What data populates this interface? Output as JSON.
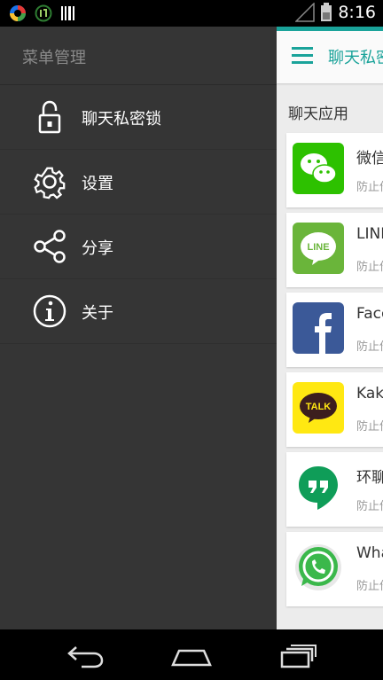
{
  "status_bar": {
    "time": "8:16"
  },
  "drawer": {
    "title": "菜单管理",
    "items": [
      {
        "label": "聊天私密锁",
        "icon": "padlock-icon"
      },
      {
        "label": "设置",
        "icon": "gear-icon"
      },
      {
        "label": "分享",
        "icon": "share-icon"
      },
      {
        "label": "关于",
        "icon": "info-icon"
      }
    ]
  },
  "main": {
    "toolbar_title": "聊天私密锁",
    "section_title": "聊天应用",
    "apps": [
      {
        "name": "微信",
        "desc": "防止他人查看",
        "icon": "wechat-icon"
      },
      {
        "name": "LINE",
        "desc": "防止他人查看",
        "icon": "line-icon"
      },
      {
        "name": "Facebook",
        "desc": "防止他人查看",
        "icon": "facebook-icon"
      },
      {
        "name": "KakaoTalk",
        "desc": "防止他人查看",
        "icon": "kakaotalk-icon"
      },
      {
        "name": "环聊",
        "desc": "防止他人查看",
        "icon": "hangouts-icon"
      },
      {
        "name": "WhatsApp",
        "desc": "防止他人查看",
        "icon": "whatsapp-icon"
      }
    ]
  },
  "colors": {
    "accent": "#1aa39a",
    "drawer_bg": "#353535"
  }
}
